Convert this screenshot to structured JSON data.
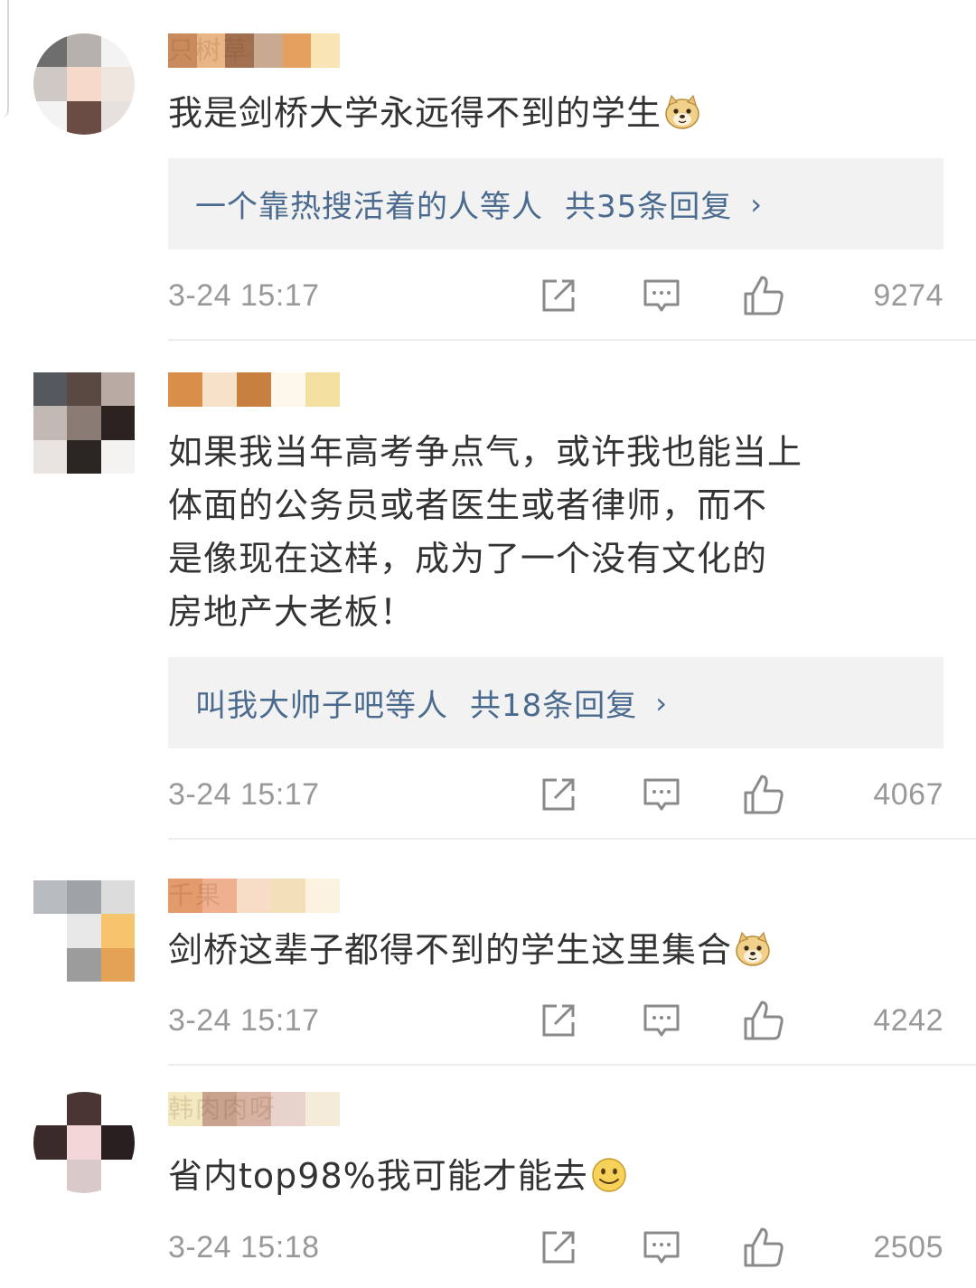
{
  "comments": [
    {
      "username": "只树草",
      "text": "我是剑桥大学永远得不到的学生",
      "emoji": "doge-emoji",
      "replies": {
        "who": "一个靠热搜活着的人等人",
        "count_label": "共35条回复"
      },
      "time": "3-24 15:17",
      "likes": "9274",
      "avatar_colors": [
        "#6e6e6e",
        "#b7b1ae",
        "#f3f3f3",
        "#cfc9c6",
        "#f6d9c8",
        "#f0e6e0",
        "#f3f3f3",
        "#6b4c45",
        "#e6e1df"
      ],
      "name_colors": [
        "#c98b5c",
        "#e9b486",
        "#a07050",
        "#c9a98f",
        "#e5a060",
        "#f9e4b4"
      ]
    },
    {
      "username": "",
      "text_lines": [
        "如果我当年高考争点气，或许我也能当上",
        "体面的公务员或者医生或者律师，而不",
        "是像现在这样，成为了一个没有文化的",
        "房地产大老板！"
      ],
      "replies": {
        "who": "叫我大帅子吧等人",
        "count_label": "共18条回复"
      },
      "time": "3-24 15:17",
      "likes": "4067",
      "avatar_colors": [
        "#55595e",
        "#5a4842",
        "#b9aba3",
        "#c2b9b4",
        "#8a7b74",
        "#2c2220",
        "#e8e4e2",
        "#2b2624",
        "#f5f3f2"
      ],
      "name_colors": [
        "#d98f4a",
        "#f6e2c8",
        "#c7803f",
        "#fdf7ec",
        "#f3dfa0"
      ]
    },
    {
      "username": "千果",
      "text": "剑桥这辈子都得不到的学生这里集合",
      "emoji": "doge-emoji",
      "time": "3-24 15:17",
      "likes": "4242",
      "avatar_colors": [
        "#b8bcc1",
        "#9fa3a7",
        "#dcdcdc",
        "#ffffff",
        "#e8e8e8",
        "#f7c46e",
        "#ffffff",
        "#9c9c9c",
        "#e3a255"
      ],
      "name_colors": [
        "#e39a6c",
        "#eeb08f",
        "#f7dcc6",
        "#f3e0b8",
        "#fbf2e0"
      ]
    },
    {
      "username": "韩肉肉呀",
      "text": "省内top98%我可能才能去",
      "emoji": "smile-emoji",
      "time": "3-24 15:18",
      "likes": "2505",
      "avatar_colors": [
        "#ffffff",
        "#4a3434",
        "#ffffff",
        "#3b2a2a",
        "#f2d6d8",
        "#2a1f20",
        "#ffffff",
        "#d9c9ca",
        "#ffffff"
      ],
      "name_colors": [
        "#f3e9c0",
        "#c9a28e",
        "#d8b3a3",
        "#e7d3cb",
        "#f4ecd9"
      ]
    }
  ],
  "colors": {
    "text": "#333333",
    "meta": "#999999",
    "reply_link": "#4a6a8e",
    "reply_bg": "#f2f2f2",
    "divider": "#eeeeee"
  },
  "icons": [
    "share-icon",
    "comment-icon",
    "like-icon",
    "chevron-right-icon",
    "doge-emoji",
    "smile-emoji"
  ]
}
